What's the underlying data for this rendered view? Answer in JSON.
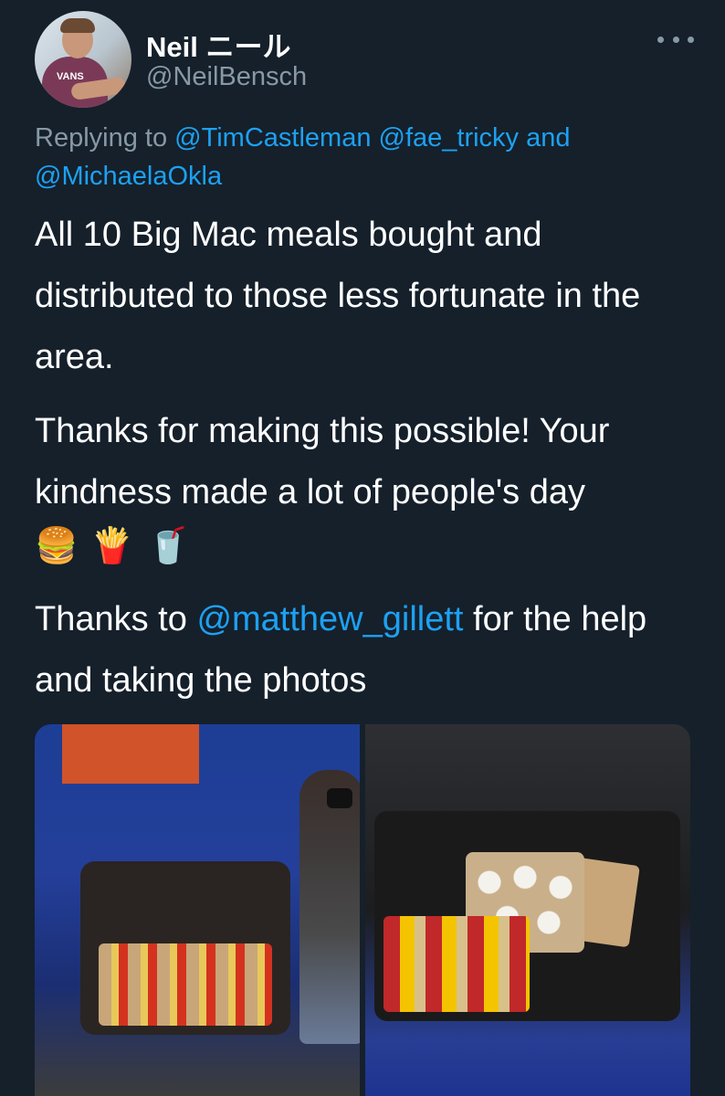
{
  "author": {
    "name": "Neil ニール",
    "handle": "@NeilBensch",
    "avatar_logo": "VANS"
  },
  "reply": {
    "prefix": "Replying to",
    "mentions": [
      "@TimCastleman",
      "@fae_tricky"
    ],
    "joiner": "and",
    "last_mention": "@MichaelaOkla"
  },
  "tweet": {
    "paragraph1": "All 10 Big Mac meals bought and distributed to those less fortunate in the area.",
    "paragraph2": "Thanks for making this possible! Your kindness made a lot of people's day",
    "emojis": [
      "🍔",
      "🍟",
      "🥤"
    ],
    "paragraph3_prefix": "Thanks to",
    "paragraph3_mention": "@matthew_gillett",
    "paragraph3_suffix": "for the help and taking the photos"
  },
  "icons": {
    "more": "more-options-icon"
  },
  "colors": {
    "background": "#15202b",
    "link": "#1da1f2",
    "secondary_text": "#8899a6"
  }
}
